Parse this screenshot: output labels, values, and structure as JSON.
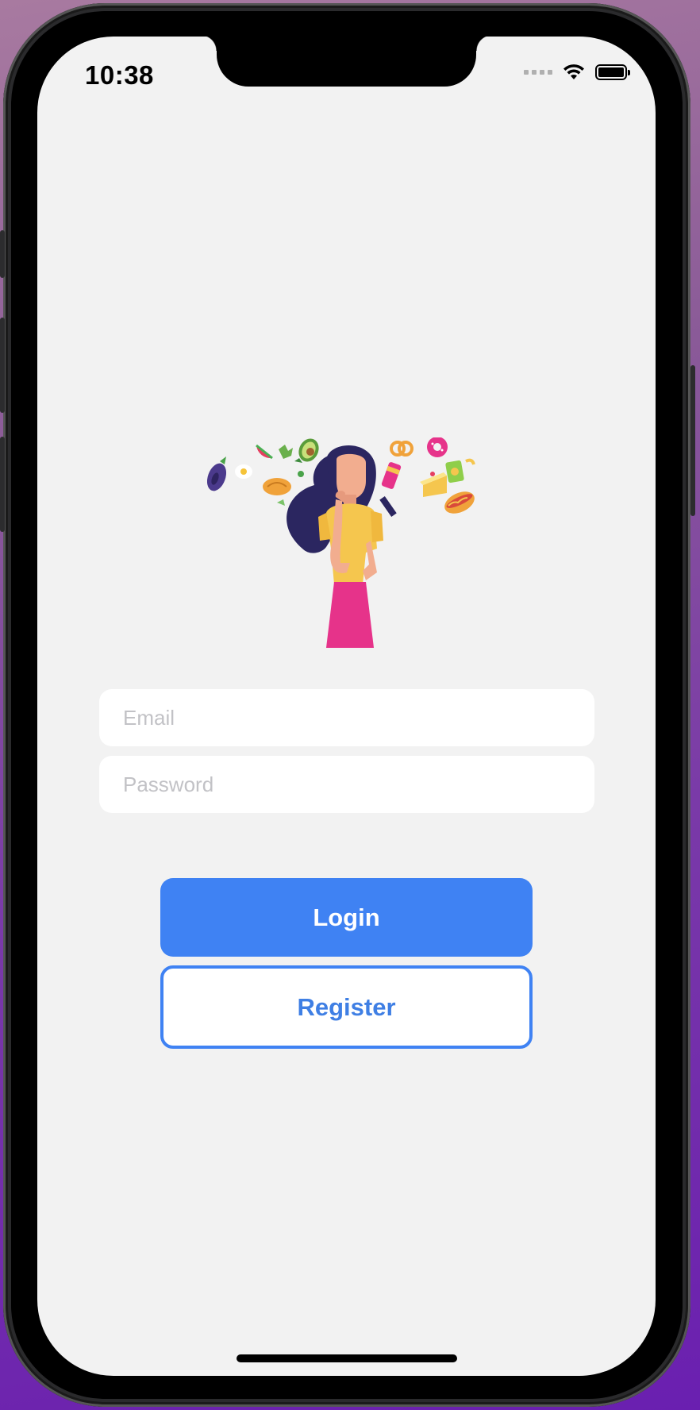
{
  "status_bar": {
    "time": "10:38"
  },
  "login_form": {
    "email_placeholder": "Email",
    "password_placeholder": "Password",
    "login_label": "Login",
    "register_label": "Register"
  },
  "colors": {
    "primary": "#3f82f3",
    "screen_background": "#f2f2f2",
    "input_background": "#ffffff",
    "placeholder": "#c2c2c6"
  },
  "illustration": {
    "icon": "woman-thinking-food-illustration"
  }
}
